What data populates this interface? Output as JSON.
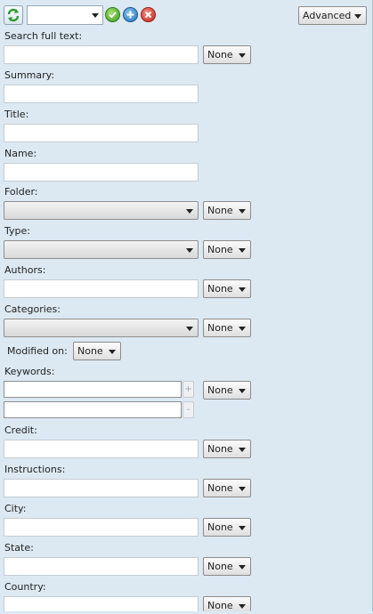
{
  "toolbar": {
    "saved_search_value": "",
    "advanced_label": "Advanced",
    "icons": [
      "refresh-icon",
      "check-icon",
      "plus-icon",
      "close-icon"
    ]
  },
  "labels": {
    "search_full_text": "Search full text:",
    "summary": "Summary:",
    "title": "Title:",
    "name": "Name:",
    "folder": "Folder:",
    "type": "Type:",
    "authors": "Authors:",
    "categories": "Categories:",
    "modified_on": "Modified on:",
    "keywords": "Keywords:",
    "credit": "Credit:",
    "instructions": "Instructions:",
    "city": "City:",
    "state": "State:",
    "country": "Country:"
  },
  "operator": "None",
  "keyword_add": "+",
  "keyword_remove": "-"
}
